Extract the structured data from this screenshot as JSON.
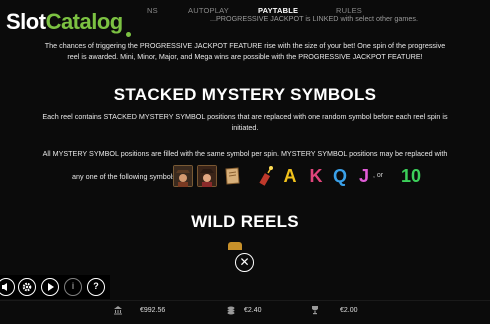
{
  "tabs": [
    {
      "label": "RULES_PARTIAL_NS",
      "text": "NS"
    },
    {
      "label": "AUTOPLAY"
    },
    {
      "label": "PAYTABLE"
    },
    {
      "label": "RULES"
    }
  ],
  "tabs_display": {
    "first": "NS",
    "autoplay": "AUTOPLAY",
    "paytable": "PAYTABLE",
    "rules": "RULES"
  },
  "logo": {
    "slot": "Slot",
    "catalog": "Catalog"
  },
  "top_cut_text": "...PROGRESSIVE JACKPOT is LINKED with select other games.",
  "paragraph1_line1": "The chances of triggering the PROGRESSIVE JACKPOT FEATURE rise with the size of your bet! One spin of the progressive",
  "paragraph1_line2": "reel is awarded. Mini, Minor, Major, and Mega wins are possible with the PROGRESSIVE JACKPOT FEATURE!",
  "heading_stacked": "STACKED MYSTERY SYMBOLS",
  "paragraph2_line1": "Each reel contains STACKED MYSTERY SYMBOL positions that are replaced with one random symbol before each reel spin is",
  "paragraph2_line2": "initiated.",
  "paragraph3": "All MYSTERY SYMBOL positions are filled with the same symbol per spin. MYSTERY SYMBOL positions may be replaced with",
  "symbols_label": "any one of the following symbols:",
  "symbols": {
    "letters": [
      "A",
      "K",
      "Q",
      "J",
      "10"
    ],
    "comma": ",",
    "or": ", or",
    "colors": {
      "a": "#f2c21b",
      "k": "#e0457b",
      "q": "#3aa0e8",
      "j": "#e05cd6",
      "ten": "#3cd05a"
    }
  },
  "heading_wild": "WILD REELS",
  "controls": {
    "close_icon": "close-icon",
    "sound_icon": "speaker-icon",
    "settings_icon": "gear-icon",
    "play_icon": "play-icon",
    "info_icon": "info-icon",
    "help_icon": "question-icon"
  },
  "bottom_bar": {
    "balance": "€992.56",
    "bet": "€2.40",
    "win": "€2.00"
  }
}
